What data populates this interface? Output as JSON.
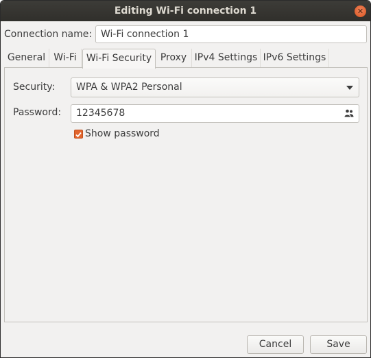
{
  "window": {
    "title": "Editing Wi-Fi connection 1"
  },
  "connection": {
    "label": "Connection name:",
    "value": "Wi-Fi connection 1"
  },
  "tabs": [
    {
      "label": "General",
      "active": false
    },
    {
      "label": "Wi-Fi",
      "active": false
    },
    {
      "label": "Wi-Fi Security",
      "active": true
    },
    {
      "label": "Proxy",
      "active": false
    },
    {
      "label": "IPv4 Settings",
      "active": false
    },
    {
      "label": "IPv6 Settings",
      "active": false
    }
  ],
  "security": {
    "label": "Security:",
    "selected": "WPA & WPA2 Personal"
  },
  "password": {
    "label": "Password:",
    "value": "12345678",
    "icon": "users-icon"
  },
  "show_password": {
    "label": "Show password",
    "checked": true
  },
  "buttons": {
    "cancel": "Cancel",
    "save": "Save"
  },
  "colors": {
    "accent": "#e2652d",
    "titlebar": "#3d3c38",
    "window_bg": "#f2f1f0"
  }
}
